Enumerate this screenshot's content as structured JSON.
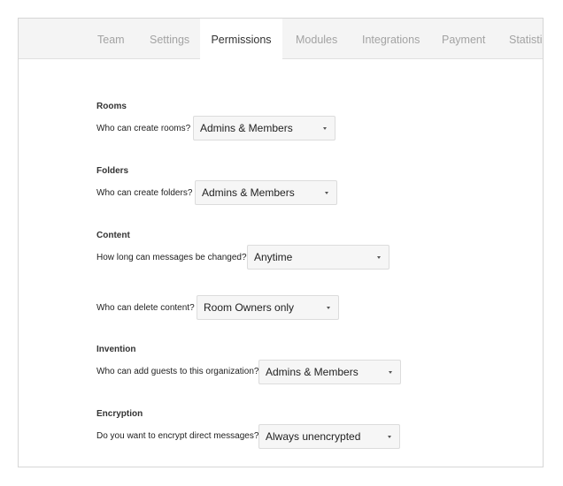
{
  "tabs": [
    {
      "label": "Team",
      "active": false
    },
    {
      "label": "Settings",
      "active": false
    },
    {
      "label": "Permissions",
      "active": true
    },
    {
      "label": "Modules",
      "active": false
    },
    {
      "label": "Integrations",
      "active": false
    },
    {
      "label": "Payment",
      "active": false
    },
    {
      "label": "Statistics",
      "active": false
    }
  ],
  "sections": {
    "rooms": {
      "title": "Rooms",
      "question": "Who can create rooms?",
      "selected": "Admins & Members"
    },
    "folders": {
      "title": "Folders",
      "question": "Who can create folders?",
      "selected": "Admins & Members"
    },
    "content": {
      "title": "Content",
      "question_edit": "How long can messages be changed?",
      "selected_edit": "Anytime",
      "question_delete": "Who can delete content?",
      "selected_delete": "Room Owners only"
    },
    "invention": {
      "title": "Invention",
      "question": "Who can add guests to this organization?",
      "selected": "Admins & Members"
    },
    "encryption": {
      "title": "Encryption",
      "question": "Do you want to encrypt direct messages?",
      "selected": "Always unencrypted"
    }
  },
  "colors": {
    "tab_inactive": "#a3a3a3",
    "tab_active": "#333333",
    "tabbar_bg": "#f4f4f4",
    "select_bg": "#f6f6f6"
  }
}
